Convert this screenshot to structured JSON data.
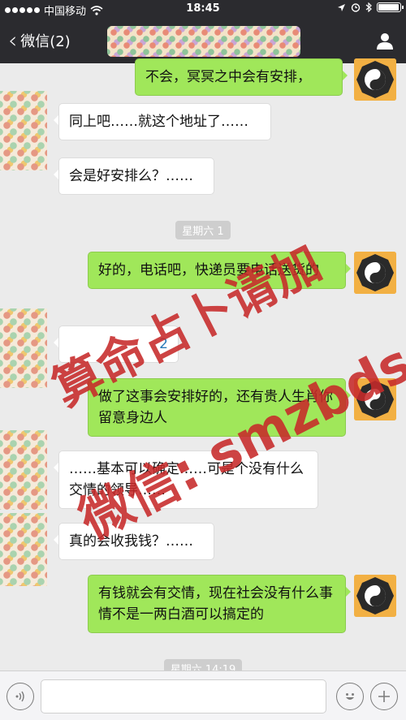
{
  "status_bar": {
    "carrier": "中国移动",
    "time": "18:45",
    "battery_level": 0.95
  },
  "nav": {
    "back_label": "微信(2)"
  },
  "messages": [
    {
      "side": "right",
      "text": "不会，冥冥之中会有安排，"
    },
    {
      "side": "left",
      "text": "同上吧……就这个地址了……"
    },
    {
      "side": "left",
      "text": "会是好安排么？……"
    },
    {
      "side": "right",
      "text": "好的，电话吧，快递员要电话送货的"
    },
    {
      "side": "left",
      "text": "2"
    },
    {
      "side": "right",
      "text": "做了这事会安排好的，还有贵人生肖你留意身边人"
    },
    {
      "side": "left",
      "text": "……基本可以确定……可是个没有什么交情的领导……"
    },
    {
      "side": "left",
      "text": "真的会收我钱？……"
    },
    {
      "side": "right",
      "text": "有钱就会有交情，现在社会没有什么事情不是一两白酒可以搞定的"
    }
  ],
  "timestamps": [
    "星期六 1",
    "星期六 14:19"
  ],
  "watermark": {
    "line1": "算命占卜请加",
    "line2": "微信: smzbds"
  },
  "input_bar": {
    "placeholder": ""
  },
  "colors": {
    "nav_bg": "#2b2b2f",
    "chat_bg": "#ebebeb",
    "bubble_right": "#a0e75a",
    "bubble_left": "#ffffff",
    "watermark": "#c72a2a"
  },
  "icons": {
    "voice": "voice-icon",
    "emoji": "emoji-icon",
    "add": "plus-icon",
    "profile": "profile-icon",
    "back": "chevron-left-icon"
  }
}
